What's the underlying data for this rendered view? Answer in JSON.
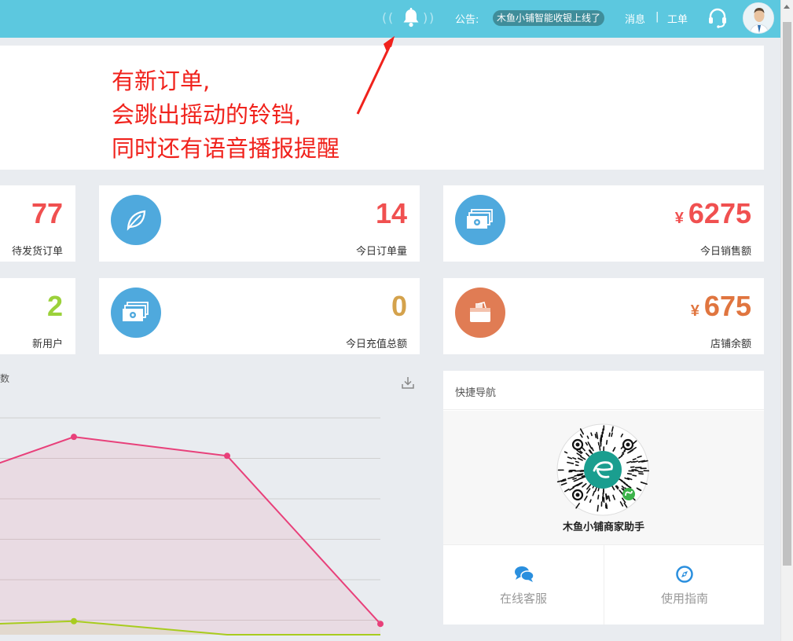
{
  "header": {
    "notice_label": "公告:",
    "notice_text": "木鱼小铺智能收银上线了",
    "messages_label": "消息",
    "separator": "|",
    "tickets_label": "工单"
  },
  "annotation": {
    "lines": [
      "有新订单,",
      "会跳出摇动的铃铛,",
      "同时还有语音播报提醒"
    ]
  },
  "stats": {
    "pending_orders": {
      "value": "77",
      "label": "待发货订单"
    },
    "today_orders": {
      "value": "14",
      "label": "今日订单量"
    },
    "today_sales": {
      "currency": "¥",
      "value": "6275",
      "label": "今日销售额"
    },
    "new_users": {
      "value": "2",
      "label": "新用户"
    },
    "today_recharge": {
      "value": "0",
      "label": "今日充值总额"
    },
    "store_balance": {
      "currency": "¥",
      "value": "675",
      "label": "店铺余额"
    }
  },
  "chart": {
    "title_fragment": "数"
  },
  "chart_data": {
    "type": "area",
    "x": [
      0,
      1,
      2,
      3
    ],
    "series": [
      {
        "values": [
          5.3,
          7.3,
          6.6,
          0.4
        ]
      },
      {
        "values": [
          0.3,
          0.5,
          0,
          0
        ]
      }
    ],
    "ylim": [
      0,
      8
    ],
    "grid": true
  },
  "quick_nav": {
    "title": "快捷导航",
    "qr_caption": "木鱼小铺商家助手",
    "online_service": "在线客服",
    "user_guide": "使用指南"
  },
  "colors": {
    "topbar": "#5cc8df",
    "red_value": "#f05050",
    "green_value": "#9bd13a",
    "yellow_value": "#d4a24c",
    "orange_value": "#e0753f",
    "blue_icon": "#4fa9dd",
    "orange_icon": "#e07c54",
    "annotation": "#f0221c"
  }
}
